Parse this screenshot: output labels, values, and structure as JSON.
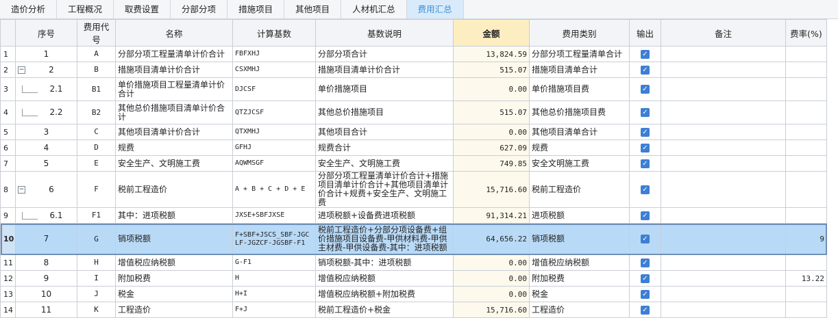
{
  "tabs": [
    "造价分析",
    "工程概况",
    "取费设置",
    "分部分项",
    "措施项目",
    "其他项目",
    "人材机汇总",
    "费用汇总"
  ],
  "active_tab": 7,
  "columns": {
    "seq": "序号",
    "code": "费用代号",
    "name": "名称",
    "base": "计算基数",
    "desc": "基数说明",
    "amount": "金额",
    "type": "费用类别",
    "output": "输出",
    "note": "备注",
    "rate": "费率(%)"
  },
  "rows": [
    {
      "row": "1",
      "seq": "1",
      "code": "A",
      "name": "分部分项工程量清单计价合计",
      "base": "FBFXHJ",
      "desc": "分部分项合计",
      "amount": "13,824.59",
      "type": "分部分项工程量清单合计",
      "rate": ""
    },
    {
      "row": "2",
      "seq": "2",
      "code": "B",
      "name": "措施项目清单计价合计",
      "base": "CSXMHJ",
      "desc": "措施项目清单计价合计",
      "amount": "515.07",
      "type": "措施项目清单合计",
      "rate": ""
    },
    {
      "row": "3",
      "seq": "2.1",
      "code": "B1",
      "name": "单价措施项目工程量清单计价合计",
      "base": "DJCSF",
      "desc": "单价措施项目",
      "amount": "0.00",
      "type": "单价措施项目费",
      "rate": ""
    },
    {
      "row": "4",
      "seq": "2.2",
      "code": "B2",
      "name": "其他总价措施项目清单计价合计",
      "base": "QTZJCSF",
      "desc": "其他总价措施项目",
      "amount": "515.07",
      "type": "其他总价措施项目费",
      "rate": ""
    },
    {
      "row": "5",
      "seq": "3",
      "code": "C",
      "name": "其他项目清单计价合计",
      "base": "QTXMHJ",
      "desc": "其他项目合计",
      "amount": "0.00",
      "type": "其他项目清单合计",
      "rate": ""
    },
    {
      "row": "6",
      "seq": "4",
      "code": "D",
      "name": "规费",
      "base": "GFHJ",
      "desc": "规费合计",
      "amount": "627.09",
      "type": "规费",
      "rate": ""
    },
    {
      "row": "7",
      "seq": "5",
      "code": "E",
      "name": "安全生产、文明施工费",
      "base": "AQWMSGF",
      "desc": "安全生产、文明施工费",
      "amount": "749.85",
      "type": "安全文明施工费",
      "rate": ""
    },
    {
      "row": "8",
      "seq": "6",
      "code": "F",
      "name": "税前工程造价",
      "base": "A + B + C + D + E",
      "desc": "分部分项工程量清单计价合计+措施项目清单计价合计+其他项目清单计价合计+规费+安全生产、文明施工费",
      "amount": "15,716.60",
      "type": "税前工程造价",
      "rate": ""
    },
    {
      "row": "9",
      "seq": "6.1",
      "code": "F1",
      "name": "其中：进项税额",
      "base": "JXSE+SBFJXSE",
      "desc": "进项税额+设备费进项税额",
      "amount": "91,314.21",
      "type": "进项税额",
      "rate": ""
    },
    {
      "row": "10",
      "seq": "7",
      "code": "G",
      "name": "销项税额",
      "base": "F+SBF+JSCS_SBF-JGCLF-JGZCF-JGSBF-F1",
      "desc": "税前工程造价+分部分项设备费+组价措施项目设备费-甲供材料费-甲供主材费-甲供设备费-其中：进项税额",
      "amount": "64,656.22",
      "type": "销项税额",
      "rate": "9"
    },
    {
      "row": "11",
      "seq": "8",
      "code": "H",
      "name": "增值税应纳税额",
      "base": "G-F1",
      "desc": "销项税额-其中：进项税额",
      "amount": "0.00",
      "type": "增值税应纳税额",
      "rate": ""
    },
    {
      "row": "12",
      "seq": "9",
      "code": "I",
      "name": "附加税费",
      "base": "H",
      "desc": "增值税应纳税额",
      "amount": "0.00",
      "type": "附加税费",
      "rate": "13.22"
    },
    {
      "row": "13",
      "seq": "10",
      "code": "J",
      "name": "税金",
      "base": "H+I",
      "desc": "增值税应纳税额+附加税费",
      "amount": "0.00",
      "type": "税金",
      "rate": ""
    },
    {
      "row": "14",
      "seq": "11",
      "code": "K",
      "name": "工程造价",
      "base": "F+J",
      "desc": "税前工程造价+税金",
      "amount": "15,716.60",
      "type": "工程造价",
      "rate": ""
    }
  ],
  "expanders": {
    "row2": "−",
    "row8": "−"
  },
  "colors": {
    "active_tab_bg": "#d9ebfa",
    "active_tab_text": "#3b8fd6",
    "selected_row": "#b9daf7",
    "amount_header": "#fdeec2",
    "checkbox": "#3d7fd4"
  },
  "icons": {
    "checkbox": "check-icon",
    "expander": "collapse-icon"
  }
}
